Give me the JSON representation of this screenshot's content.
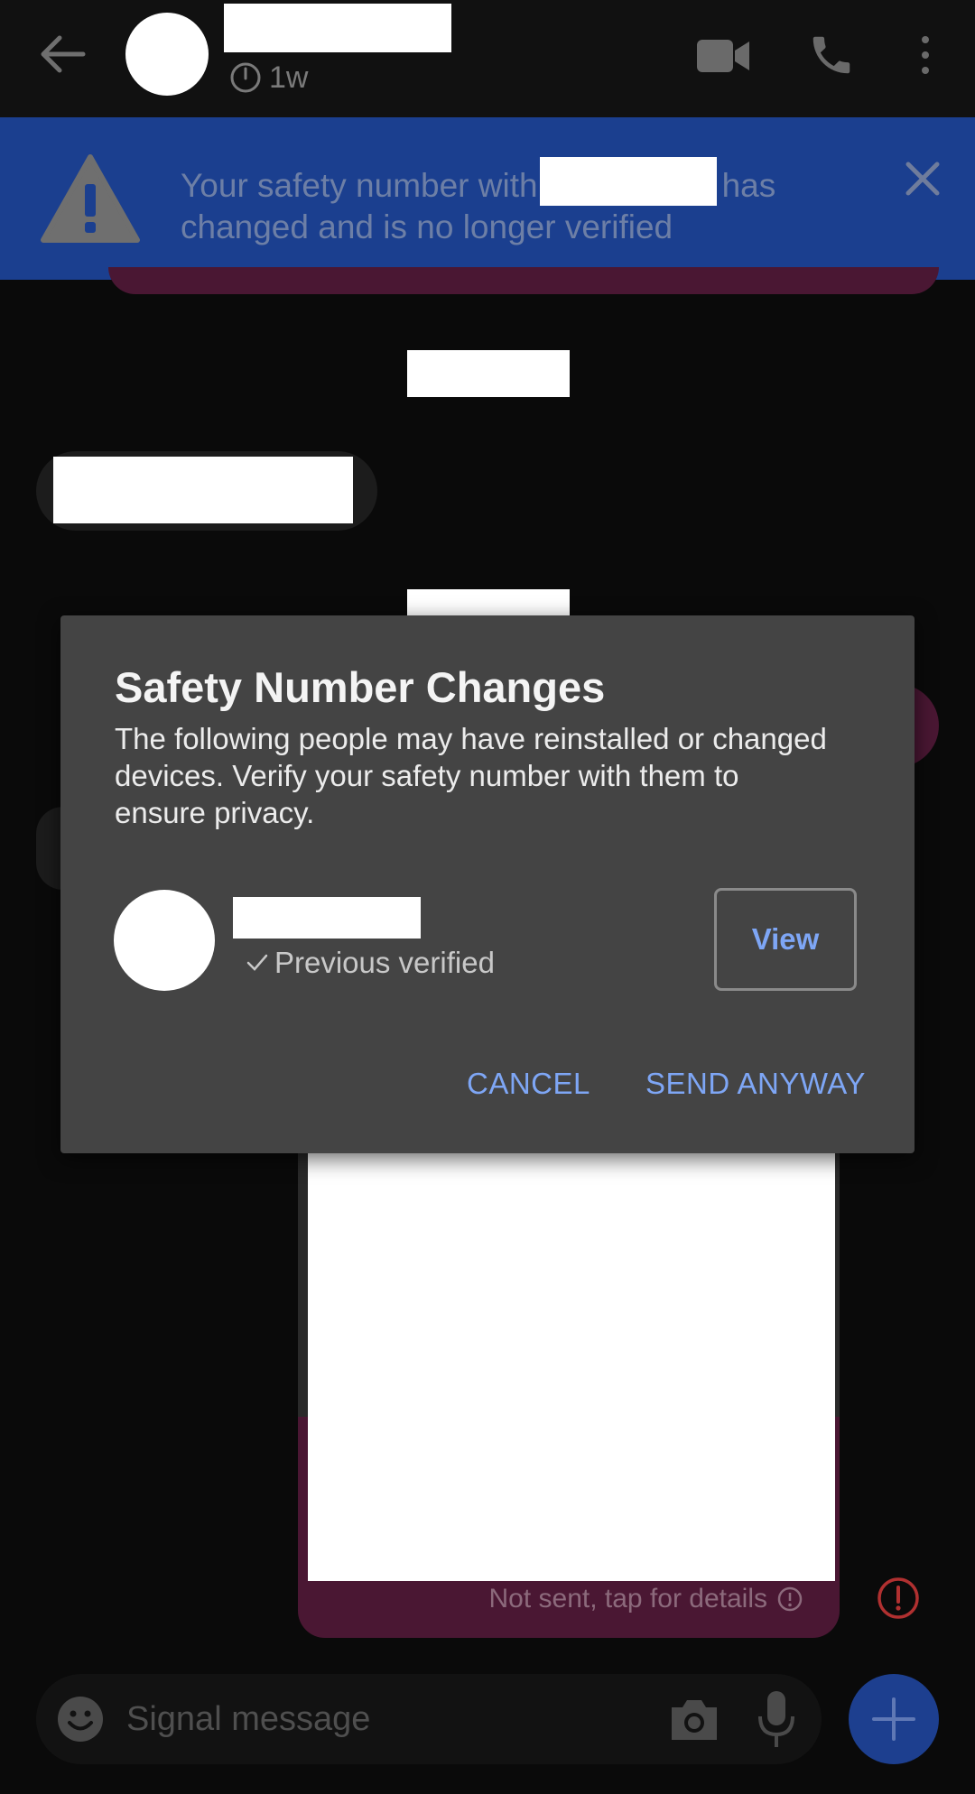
{
  "header": {
    "contact_name": "",
    "disappearing_timer": "1w",
    "icons": [
      "back-arrow-icon",
      "video-call-icon",
      "phone-call-icon",
      "more-vertical-icon"
    ]
  },
  "banner": {
    "text_before": "Your safety number with",
    "text_after": "has changed and is no longer verified",
    "icon": "warning-triangle-icon",
    "close_icon": "close-icon"
  },
  "conversation": {
    "not_sent_text": "Not sent, tap for details"
  },
  "composer": {
    "placeholder": "Signal message",
    "icons": [
      "emoji-icon",
      "camera-icon",
      "microphone-icon",
      "plus-icon"
    ]
  },
  "dialog": {
    "title": "Safety Number Changes",
    "body": "The following people may have reinstalled or changed devices. Verify your safety number with them to ensure privacy.",
    "recipient_status": "Previous verified",
    "view_label": "View",
    "cancel_label": "CANCEL",
    "send_label": "SEND ANYWAY"
  },
  "colors": {
    "banner_bg": "#1b3f8f",
    "accent": "#7ea6f5",
    "dialog_bg": "#444444",
    "outgoing_bubble": "#4a1733",
    "error_red": "#c0392b"
  }
}
